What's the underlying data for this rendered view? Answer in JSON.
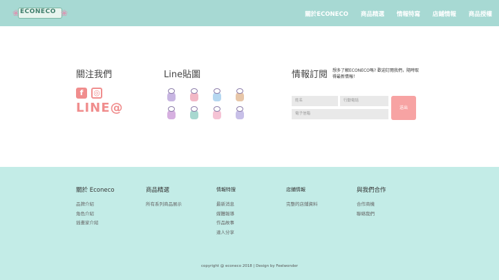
{
  "header": {
    "logo_text": "ECONECO",
    "nav": [
      "關於ECONECO",
      "商品精選",
      "情報特寫",
      "店鋪情報",
      "商品授權"
    ]
  },
  "follow": {
    "title": "關注我們",
    "line_at": "LINE@"
  },
  "line_stickers": {
    "title": "Line貼圖",
    "stickers": [
      "#c8b6e2",
      "#f2b8c6",
      "#b5d7f0",
      "#e7c6a8",
      "#d6b0e0",
      "#a8d8d0",
      "#f5c3d5",
      "#c8c0e8"
    ]
  },
  "newsletter": {
    "title": "情報訂閱",
    "description": "想多了解ECONECO嗎? 歡迎訂閱我們，隨時取得最新情報！",
    "name_placeholder": "姓名",
    "phone_placeholder": "行動電話",
    "email_placeholder": "電子信箱",
    "send_label": "送出"
  },
  "footer": {
    "about": {
      "title": "關於 Econeco",
      "items": [
        "品牌介紹",
        "角色介紹",
        "插畫家介紹"
      ]
    },
    "products": {
      "title": "商品精選",
      "items": [
        "所有系列商品展示"
      ]
    },
    "info": {
      "title": "情報特搜",
      "items": [
        "最新消息",
        "媒體報導",
        "作品故事",
        "達人分享"
      ]
    },
    "stores": {
      "title": "店鋪情報",
      "items": [
        "完整的店鋪資料"
      ]
    },
    "cooperate": {
      "title": "與我們合作",
      "items": [
        "合作商機",
        "聯絡我們"
      ]
    },
    "copyright": "copyright @ econeco 2018 | Design by Feelwonder"
  },
  "colors": {
    "header_bg": "#a7d9d3",
    "footer_bg": "#c3ece7",
    "accent_pink": "#f08d8d",
    "button_pink": "#f7a3a3"
  }
}
